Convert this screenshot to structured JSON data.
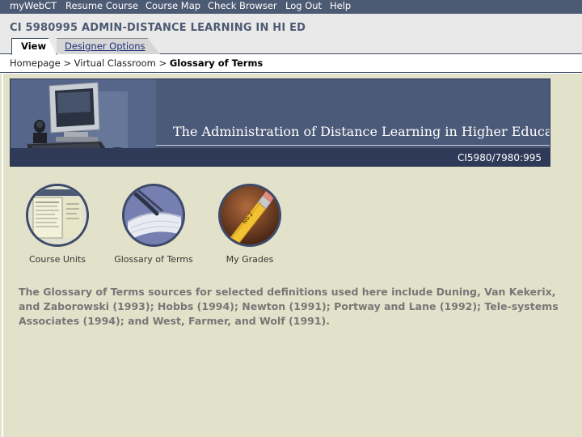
{
  "topnav": {
    "items": [
      "myWebCT",
      "Resume Course",
      "Course Map",
      "Check Browser",
      "Log Out",
      "Help"
    ]
  },
  "course": {
    "title": "CI 5980995 ADMIN-DISTANCE LEARNING IN HI ED"
  },
  "tabs": [
    {
      "label": "View",
      "active": true
    },
    {
      "label": "Designer Options",
      "active": false
    }
  ],
  "breadcrumb": {
    "items": [
      "Homepage",
      "Virtual Classroom"
    ],
    "separator": ">",
    "current": "Glossary of Terms"
  },
  "banner": {
    "title": "The Administration of Distance Learning in Higher Education",
    "code": "CI5980/7980:995"
  },
  "nav_icons": [
    {
      "label": "Course Units",
      "icon": "course-units-icon"
    },
    {
      "label": "Glossary of Terms",
      "icon": "book-icon"
    },
    {
      "label": "My Grades",
      "icon": "pencil-icon"
    }
  ],
  "description": "The Glossary of Terms sources for selected definitions used here include Duning, Van Kekerix, and Zaborowski (1993); Hobbs (1994); Newton (1991); Portway and Lane (1992); Tele-systems Associates (1994); and West, Farmer, and Wolf (1991).",
  "colors": {
    "nav_bg": "#4d5a74",
    "course_title": "#4c5a72",
    "content_bg": "#e2e1ca",
    "banner_bg": "#4a5a78"
  }
}
